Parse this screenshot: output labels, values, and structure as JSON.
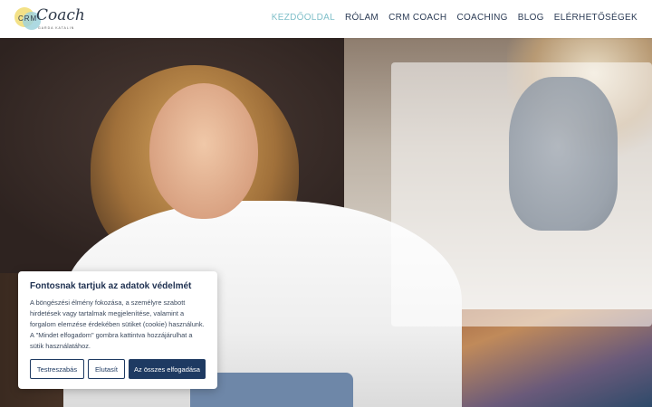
{
  "header": {
    "logo": {
      "crm": "CRM",
      "script": "Coach",
      "subtitle": "GARDA KATALIN"
    },
    "nav": [
      {
        "label": "KEZDŐOLDAL",
        "active": true
      },
      {
        "label": "RÓLAM",
        "active": false
      },
      {
        "label": "CRM COACH",
        "active": false
      },
      {
        "label": "COACHING",
        "active": false
      },
      {
        "label": "BLOG",
        "active": false
      },
      {
        "label": "ELÉRHETŐSÉGEK",
        "active": false
      }
    ]
  },
  "colors": {
    "nav_text": "#2b3b55",
    "nav_active": "#7fbfc9",
    "primary_button": "#1e3a62"
  },
  "cookie": {
    "title": "Fontosnak tartjuk az adatok védelmét",
    "lines": [
      "A böngészési élmény fokozása, a személyre szabott",
      "hirdetések vagy tartalmak megjelenítése, valamint a",
      "forgalom elemzése érdekében sütiket (cookie) használunk.",
      "A \"Mindet elfogadom\" gombra kattintva hozzájárulhat a",
      "sütik használatához."
    ],
    "buttons": {
      "customize": "Testreszabás",
      "reject": "Elutasít",
      "accept_all": "Az összes elfogadása"
    }
  }
}
